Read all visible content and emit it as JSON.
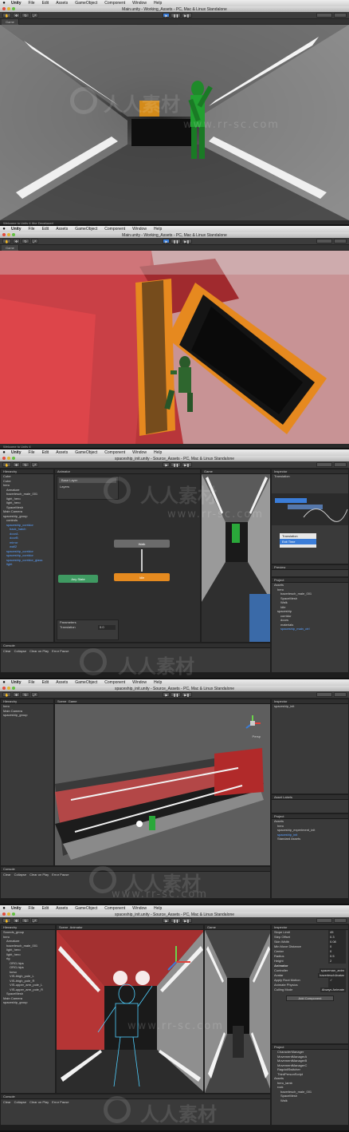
{
  "menu": {
    "app": "Unity",
    "items": [
      "File",
      "Edit",
      "Assets",
      "GameObject",
      "Component",
      "Window",
      "Help"
    ]
  },
  "shot1": {
    "title": "Main.unity - Working_Assets - PC, Mac & Linux Standalone",
    "tab": "Game",
    "status": "Welcome to Unity 4 (the Developer)"
  },
  "shot2": {
    "title": "Main.unity - Working_Assets - PC, Mac & Linux Standalone",
    "tab": "Game",
    "status": "Welcome to Unity 4"
  },
  "shot3": {
    "title": "spaceship_init.unity - Source_Assets - PC, Mac & Linux Standalone",
    "hierarchy_title": "Hierarchy",
    "hierarchy": [
      "Cube",
      "Cube",
      "hero",
      "Armature",
      "bazerlesch_male_001",
      "light_hero",
      "light_hero",
      "SpaceMesh",
      "Main Camera",
      "spaceship_group",
      "controls",
      "spaceship_corridor",
      "back_hatch",
      "doorA",
      "doorB",
      "mirror",
      "wall2",
      "spaceship_corridor",
      "spaceship_corridor",
      "spaceship_corridor_glass",
      "light"
    ],
    "animator_tab": "Animator",
    "base_layer": "Base Layer",
    "layers": "Layers",
    "node_walk": "Walk",
    "node_idle": "Idle",
    "node_any": "Any State",
    "params_title": "Parameters",
    "param_name": "Translation",
    "param_value": "0.0",
    "game_tab": "Game",
    "inspector_tab": "Inspector",
    "inspector_item": "Translation",
    "dropdown": [
      "Translation",
      "Exit Time"
    ],
    "preview": "Preview",
    "project_title": "Project",
    "project_items": [
      "Assets",
      "hero",
      "bazerlesch_male_001",
      "SpaceMesh",
      "Walk",
      "Idle",
      "spaceship",
      "corridor",
      "doors",
      "materials",
      "spaceship_main_ctrl"
    ],
    "console": "Console",
    "console_btns": [
      "Clear",
      "Collapse",
      "Clear on Play",
      "Error Pause"
    ]
  },
  "shot4": {
    "title": "spaceship_init.unity - Source_Assets - PC, Mac & Linux Standalone",
    "hierarchy": [
      "hero",
      "Main Camera",
      "spaceship_group"
    ],
    "scene_tab": "Scene",
    "game_tab": "Game",
    "inspector_item": "spaceship_init",
    "persp": "Persp",
    "asset_labels": "Asset Labels",
    "project_items": [
      "Assets",
      "hero",
      "spaceship_experiment_init",
      "spaceship_init",
      "Standard Assets"
    ],
    "console": "Console",
    "console_btns": [
      "Clear",
      "Collapse",
      "Clear on Play",
      "Error Pause"
    ]
  },
  "shot5": {
    "title": "spaceship_init.unity - Source_Assets - PC, Mac & Linux Standalone",
    "hierarchy": [
      "Sounds_group",
      "hero",
      "Armature",
      "bazerlesch_male_001",
      "light_hero",
      "light_hero",
      "rig",
      "ORG-hips",
      "ORG-hips",
      "torso",
      "VIS-thigh_pole_L",
      "VIS-thigh_pole_R",
      "VIS-upper_arm_pole_L",
      "VIS-upper_arm_pole_R",
      "SpaceMesh",
      "Main Camera",
      "spaceship_group"
    ],
    "scene_tab": "Scene",
    "animator_tab": "Animator",
    "game_tab": "Game",
    "inspector": [
      {
        "label": "Slope Limit",
        "value": "45"
      },
      {
        "label": "Step Offset",
        "value": "0.3"
      },
      {
        "label": "Skin Width",
        "value": "0.08"
      },
      {
        "label": "Min Move Distance",
        "value": "0"
      },
      {
        "label": "Center",
        "value": "0"
      },
      {
        "label": "Radius",
        "value": "0.5"
      },
      {
        "label": "Height",
        "value": "2"
      },
      {
        "label": "Animator",
        "value": ""
      },
      {
        "label": "Controller",
        "value": "spaceman_anim"
      },
      {
        "label": "Avatar",
        "value": "bazerleschAvatar"
      },
      {
        "label": "Apply Root Motion",
        "value": "✓"
      },
      {
        "label": "Animate Physics",
        "value": ""
      },
      {
        "label": "Culling Mode",
        "value": "Always Animate"
      }
    ],
    "add_component": "Add Component",
    "project_items": [
      "CharacterManager",
      "MovementManagerA",
      "MovementManagerB",
      "MovementManagerC",
      "RagdollSwitcher",
      "ThirdPersonScript",
      "Assets",
      "hero_lamb",
      "rock",
      "bazerlesch_male_001",
      "SpaceMesh",
      "Walk"
    ],
    "console": "Console",
    "console_btns": [
      "Clear",
      "Collapse",
      "Clear on Play",
      "Error Pause"
    ]
  },
  "watermark": {
    "text": "人人素材",
    "url": "www.rr-sc.com"
  },
  "colors": {
    "accent_blue": "#3b7dd8",
    "node_orange": "#e58a1f",
    "node_green": "#3f9a62",
    "node_gray": "#6b6b6b"
  }
}
